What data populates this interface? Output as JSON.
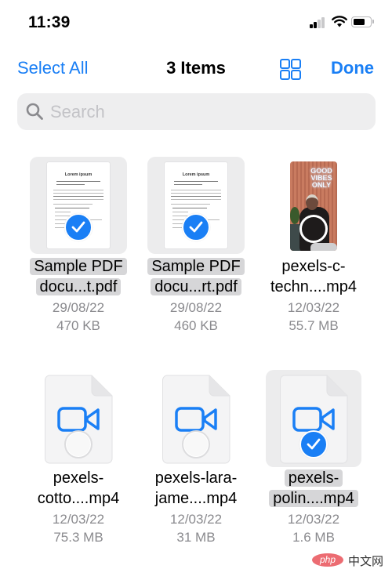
{
  "status_bar": {
    "time": "11:39",
    "icons": [
      "cellular-signal-icon",
      "wifi-icon",
      "battery-icon"
    ]
  },
  "nav": {
    "select_all_label": "Select All",
    "title": "3 Items",
    "view_toggle_icon": "grid-view-icon",
    "done_label": "Done"
  },
  "search": {
    "placeholder": "Search",
    "value": "",
    "icon": "magnifier-icon"
  },
  "colors": {
    "accent": "#1a7ff5",
    "selection_highlight": "#d6d6d8",
    "secondary_text": "#8a8a8e",
    "search_bg": "#eeeeef"
  },
  "files": [
    {
      "name_line1": "Sample PDF",
      "name_line2": "docu...t.pdf",
      "date": "29/08/22",
      "size": "470 KB",
      "type": "pdf",
      "selected": true,
      "thumb_title": "Lorem ipsum"
    },
    {
      "name_line1": "Sample PDF",
      "name_line2": "docu...rt.pdf",
      "date": "29/08/22",
      "size": "460 KB",
      "type": "pdf",
      "selected": true,
      "thumb_title": "Lorem ipsum"
    },
    {
      "name_line1": "pexels-c-",
      "name_line2": "techn....mp4",
      "date": "12/03/22",
      "size": "55.7 MB",
      "type": "video-thumbnail",
      "selected": false,
      "thumb_text": "GOOD VIBES ONLY"
    },
    {
      "name_line1": "pexels-",
      "name_line2": "cotto....mp4",
      "date": "12/03/22",
      "size": "75.3 MB",
      "type": "video-file",
      "selected": false
    },
    {
      "name_line1": "pexels-lara-",
      "name_line2": "jame....mp4",
      "date": "12/03/22",
      "size": "31 MB",
      "type": "video-file",
      "selected": false
    },
    {
      "name_line1": "pexels-",
      "name_line2": "polin....mp4",
      "date": "12/03/22",
      "size": "1.6 MB",
      "type": "video-file",
      "selected": true
    }
  ],
  "watermark": {
    "badge": "php",
    "text": "中文网"
  }
}
